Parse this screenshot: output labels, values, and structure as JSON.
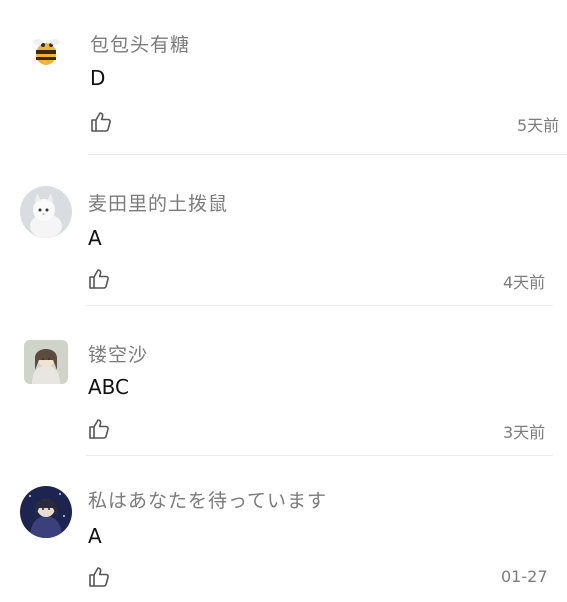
{
  "comments": [
    {
      "username": "包包头有糖",
      "content": "D",
      "time": "5天前",
      "avatar_icon": "bee-avatar-icon",
      "like_icon": "thumbs-up-icon"
    },
    {
      "username": "麦田里的土拨鼠",
      "content": "A",
      "time": "4天前",
      "avatar_icon": "white-cat-avatar-icon",
      "like_icon": "thumbs-up-icon"
    },
    {
      "username": "镂空沙",
      "content": "ABC",
      "time": "3天前",
      "avatar_icon": "anime-character-avatar-icon",
      "like_icon": "thumbs-up-icon"
    },
    {
      "username": "私はあなたを待っています",
      "content": "A",
      "time": "01-27",
      "avatar_icon": "night-anime-avatar-icon",
      "like_icon": "thumbs-up-icon"
    }
  ],
  "colors": {
    "username": "#7b7b7b",
    "content": "#111111",
    "time": "#7d7d7d",
    "divider": "#ececec",
    "icon_stroke": "#555555"
  }
}
